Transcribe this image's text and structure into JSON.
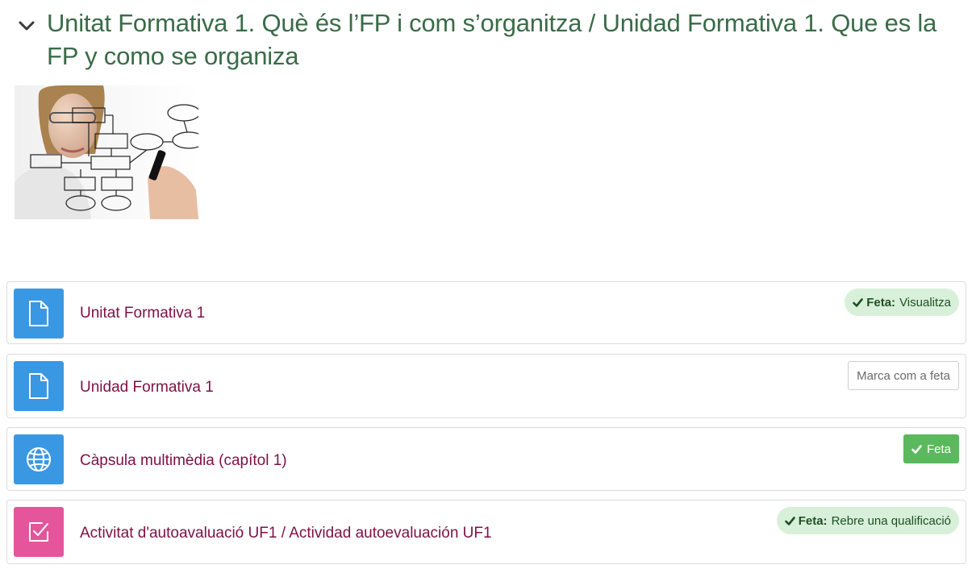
{
  "section": {
    "title": "Unitat Formativa 1. Què és l’FP i com s’organitza / Unidad Formativa 1. Que es la FP y como se organiza",
    "image_alt": "flowchart-drawing-image"
  },
  "activities": [
    {
      "name": "Unitat Formativa 1",
      "icon": "file-icon",
      "status_bold": "Feta:",
      "status_text": "Visualitza"
    },
    {
      "name": "Unidad Formativa 1",
      "icon": "file-icon",
      "button_label": "Marca com a feta"
    },
    {
      "name": "Càpsula multimèdia (capítol 1)",
      "icon": "globe-icon",
      "button_label": "Feta"
    },
    {
      "name": "Activitat d'autoavaluació UF1 / Actividad autoevaluación UF1",
      "icon": "quiz-icon",
      "status_bold": "Feta:",
      "status_text": "Rebre una qualificació"
    }
  ],
  "colors": {
    "title": "#3a6b48",
    "link": "#7d1046",
    "resource_icon": "#3a98e3",
    "quiz_icon": "#e5559b",
    "done_badge": "#d8f0d9",
    "done_button": "#5cb85c"
  }
}
